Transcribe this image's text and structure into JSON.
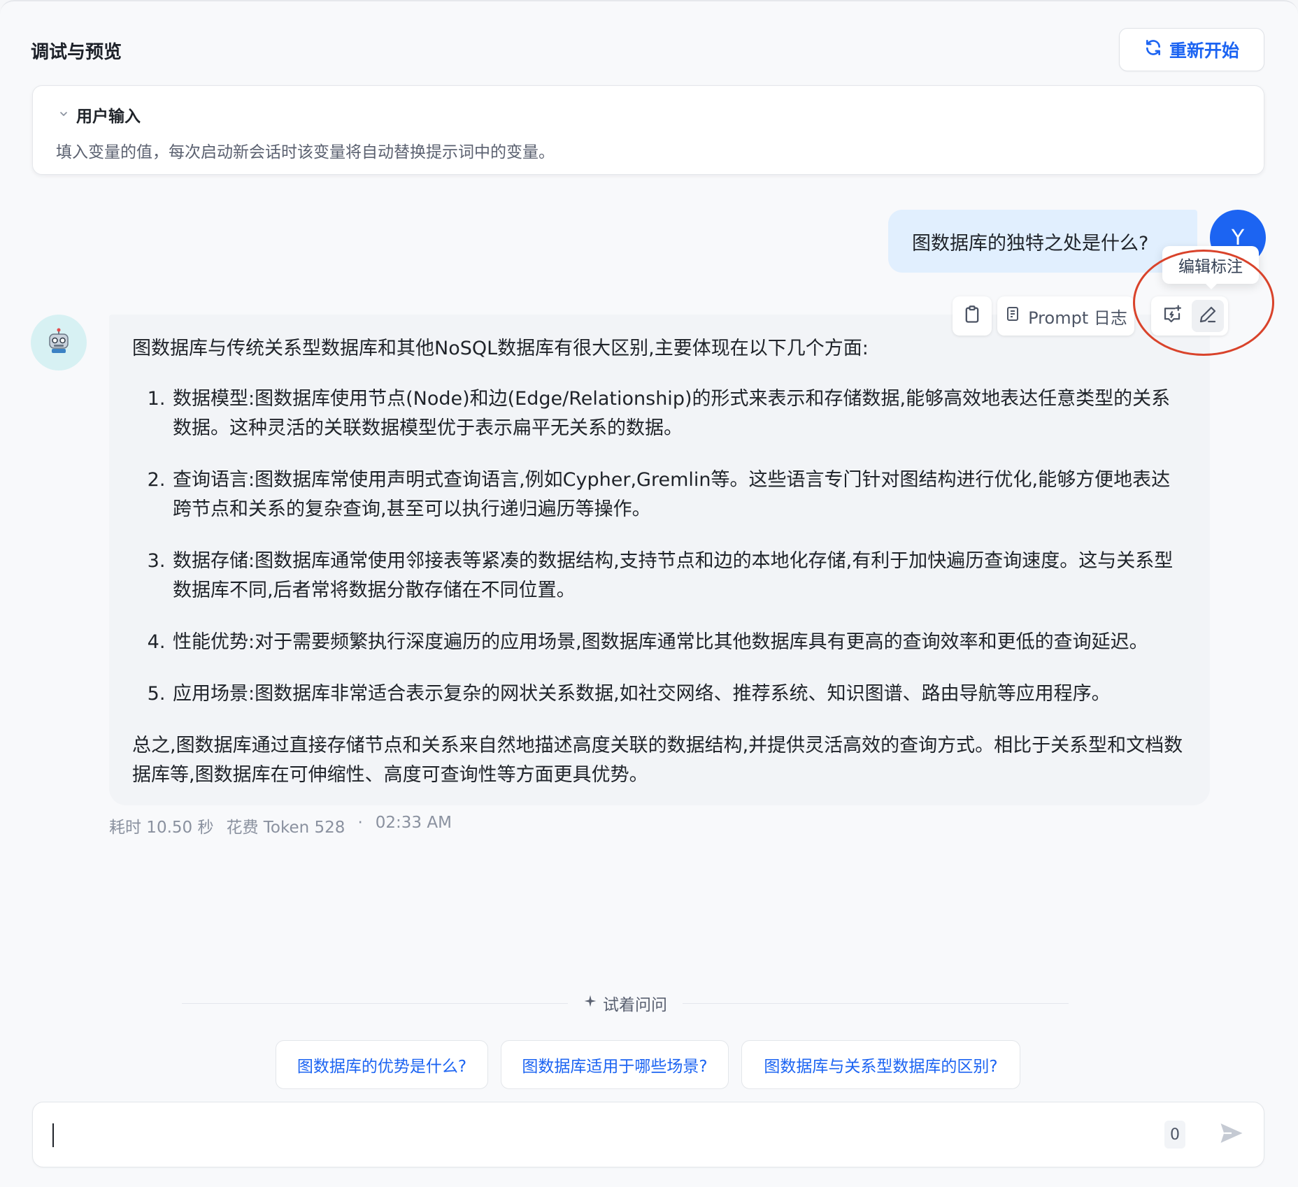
{
  "header": {
    "title": "调试与预览",
    "restart_label": "重新开始"
  },
  "user_input_panel": {
    "title": "用户输入",
    "description": "填入变量的值，每次启动新会话时该变量将自动替换提示词中的变量。"
  },
  "user_message": {
    "text": "图数据库的独特之处是什么?",
    "avatar_initial": "Y"
  },
  "tooltip": {
    "text": "编辑标注"
  },
  "toolbar": {
    "prompt_log_label": "Prompt 日志"
  },
  "bot_message": {
    "intro": "图数据库与传统关系型数据库和其他NoSQL数据库有很大区别,主要体现在以下几个方面:",
    "items": [
      "数据模型:图数据库使用节点(Node)和边(Edge/Relationship)的形式来表示和存储数据,能够高效地表达任意类型的关系数据。这种灵活的关联数据模型优于表示扁平无关系的数据。",
      "查询语言:图数据库常使用声明式查询语言,例如Cypher,Gremlin等。这些语言专门针对图结构进行优化,能够方便地表达跨节点和关系的复杂查询,甚至可以执行递归遍历等操作。",
      "数据存储:图数据库通常使用邻接表等紧凑的数据结构,支持节点和边的本地化存储,有利于加快遍历查询速度。这与关系型数据库不同,后者常将数据分散存储在不同位置。",
      "性能优势:对于需要频繁执行深度遍历的应用场景,图数据库通常比其他数据库具有更高的查询效率和更低的查询延迟。",
      "应用场景:图数据库非常适合表示复杂的网状关系数据,如社交网络、推荐系统、知识图谱、路由导航等应用程序。"
    ],
    "summary": "总之,图数据库通过直接存储节点和关系来自然地描述高度关联的数据结构,并提供灵活高效的查询方式。相比于关系型和文档数据库等,图数据库在可伸缩性、高度可查询性等方面更具优势。"
  },
  "meta": {
    "duration": "耗时 10.50 秒",
    "tokens": "花费 Token 528",
    "separator": "·",
    "time": "02:33 AM"
  },
  "suggestions": {
    "label": "试着问问",
    "items": [
      "图数据库的优势是什么?",
      "图数据库适用于哪些场景?",
      "图数据库与关系型数据库的区别?"
    ]
  },
  "chat_input": {
    "value": "",
    "char_count": "0"
  },
  "colors": {
    "accent": "#1c64f2",
    "annotation_circle": "#d9432b"
  }
}
